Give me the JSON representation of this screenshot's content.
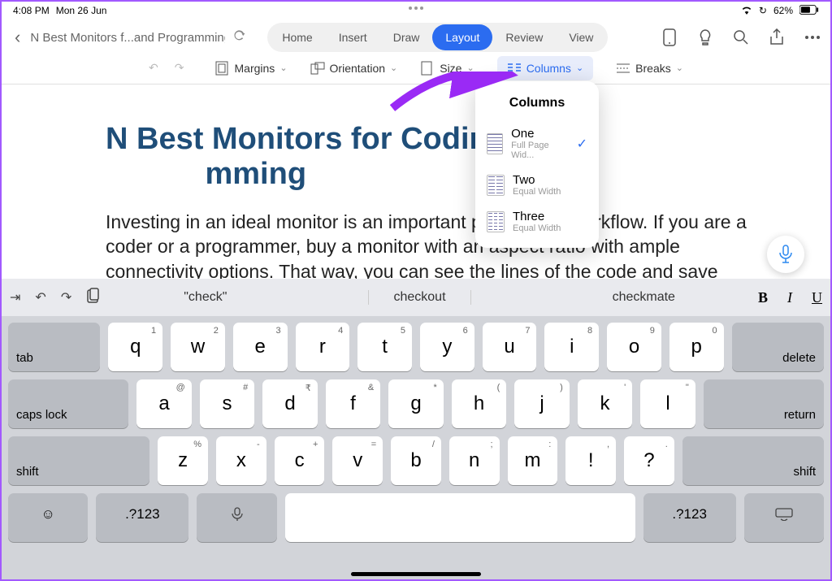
{
  "status": {
    "time": "4:08 PM",
    "date": "Mon 26 Jun",
    "battery": "62%"
  },
  "doc_title": "N Best Monitors f...and Programming",
  "tabs": {
    "home": "Home",
    "insert": "Insert",
    "draw": "Draw",
    "layout": "Layout",
    "review": "Review",
    "view": "View"
  },
  "toolbar": {
    "margins": "Margins",
    "orientation": "Orientation",
    "size": "Size",
    "columns": "Columns",
    "breaks": "Breaks"
  },
  "popover": {
    "title": "Columns",
    "items": [
      {
        "main": "One",
        "sub": "Full Page Wid...",
        "checked": true
      },
      {
        "main": "Two",
        "sub": "Equal Width",
        "checked": false
      },
      {
        "main": "Three",
        "sub": "Equal Width",
        "checked": false
      }
    ]
  },
  "document": {
    "heading": "N Best Monitors for Coding and Programming",
    "heading_visible": "N Best Monitors for Coding a                  mming",
    "body": "Investing in an ideal monitor is an important part of your workflow. If you are a coder or a programmer, buy a monitor with an aspect ratio with ample connectivity options. That way, you can see the lines of the code and save yourself from constant scrolling. With several manufactures and"
  },
  "keyboard": {
    "suggestions": [
      "\"check\"",
      "checkout",
      "checkmate"
    ],
    "row1": [
      {
        "k": "q",
        "s": "1"
      },
      {
        "k": "w",
        "s": "2"
      },
      {
        "k": "e",
        "s": "3"
      },
      {
        "k": "r",
        "s": "4"
      },
      {
        "k": "t",
        "s": "5"
      },
      {
        "k": "y",
        "s": "6"
      },
      {
        "k": "u",
        "s": "7"
      },
      {
        "k": "i",
        "s": "8"
      },
      {
        "k": "o",
        "s": "9"
      },
      {
        "k": "p",
        "s": "0"
      }
    ],
    "row2": [
      {
        "k": "a",
        "s": "@"
      },
      {
        "k": "s",
        "s": "#"
      },
      {
        "k": "d",
        "s": "₹"
      },
      {
        "k": "f",
        "s": "&"
      },
      {
        "k": "g",
        "s": "*"
      },
      {
        "k": "h",
        "s": "("
      },
      {
        "k": "j",
        "s": ")"
      },
      {
        "k": "k",
        "s": "'"
      },
      {
        "k": "l",
        "s": "\""
      }
    ],
    "row3": [
      {
        "k": "z",
        "s": "%"
      },
      {
        "k": "x",
        "s": "-"
      },
      {
        "k": "c",
        "s": "+"
      },
      {
        "k": "v",
        "s": "="
      },
      {
        "k": "b",
        "s": "/"
      },
      {
        "k": "n",
        "s": ";"
      },
      {
        "k": "m",
        "s": ":"
      },
      {
        "k": "!",
        "s": ","
      },
      {
        "k": "?",
        "s": "."
      }
    ],
    "mods": {
      "tab": "tab",
      "delete": "delete",
      "caps": "caps lock",
      "return": "return",
      "shift": "shift",
      "num": ".?123"
    }
  }
}
